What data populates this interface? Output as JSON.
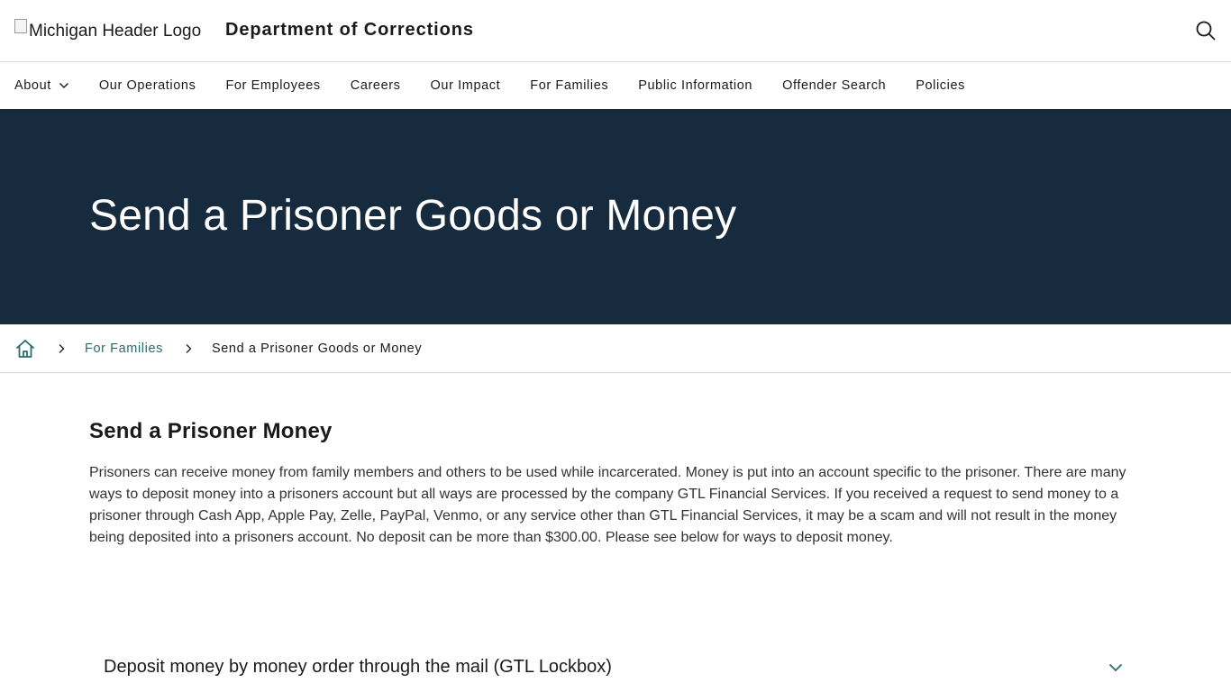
{
  "header": {
    "logo_alt": "Michigan Header Logo",
    "department": "Department of Corrections",
    "search_icon": "search-icon"
  },
  "nav": {
    "items": [
      {
        "label": "About",
        "has_dropdown": true
      },
      {
        "label": "Our Operations"
      },
      {
        "label": "For Employees"
      },
      {
        "label": "Careers"
      },
      {
        "label": "Our Impact"
      },
      {
        "label": "For Families"
      },
      {
        "label": "Public Information"
      },
      {
        "label": "Offender Search"
      },
      {
        "label": "Policies"
      }
    ]
  },
  "hero": {
    "title": "Send a Prisoner Goods or Money"
  },
  "breadcrumb": {
    "home_icon": "home-icon",
    "parent": "For Families",
    "current": "Send a Prisoner Goods or Money"
  },
  "main": {
    "heading": "Send a Prisoner Money",
    "paragraph": "Prisoners can receive money from family members and others to be used while incarcerated. Money is put into an account specific to the prisoner. There are many ways to deposit money into a prisoners account but all ways are processed by the company GTL Financial Services. If you received a request to send money to a prisoner through Cash App, Apple Pay, Zelle, PayPal, Venmo, or any service other than GTL Financial Services, it may be a scam and will not result in the money being deposited into a prisoners account. No deposit can be more than $300.00. Please see below for ways to deposit money."
  },
  "accordion": {
    "title": "Deposit money by money order through the mail (GTL Lockbox)",
    "expanded": false
  },
  "colors": {
    "hero_bg": "#162b3d",
    "link": "#2b6b6f",
    "accent": "#2b6b6f"
  }
}
